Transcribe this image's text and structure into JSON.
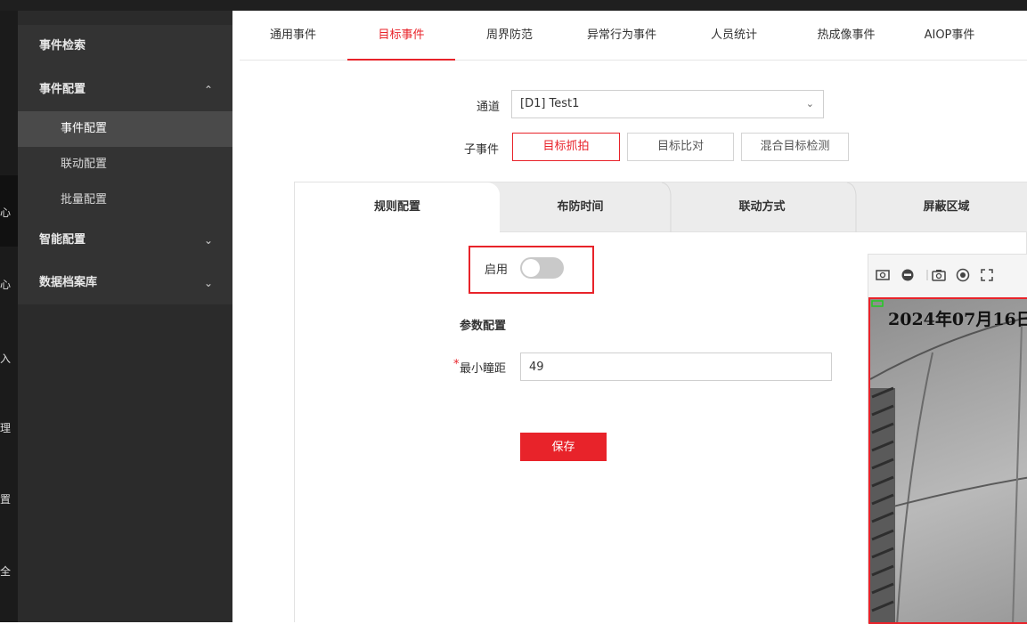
{
  "sidebar": {
    "items": [
      {
        "label": "事件检索"
      },
      {
        "label": "事件配置"
      },
      {
        "label": "智能配置"
      },
      {
        "label": "数据档案库"
      }
    ],
    "sub_items": [
      {
        "label": "事件配置"
      },
      {
        "label": "联动配置"
      },
      {
        "label": "批量配置"
      }
    ],
    "rail_glyphs": [
      "心",
      "心",
      "入",
      "理",
      "置",
      "全"
    ]
  },
  "tabs": [
    {
      "label": "通用事件"
    },
    {
      "label": "目标事件"
    },
    {
      "label": "周界防范"
    },
    {
      "label": "异常行为事件"
    },
    {
      "label": "人员统计"
    },
    {
      "label": "热成像事件"
    },
    {
      "label": "AIOP事件"
    }
  ],
  "form": {
    "channel_label": "通道",
    "channel_value": "[D1] Test1",
    "subevent_label": "子事件",
    "subevents": [
      {
        "label": "目标抓拍"
      },
      {
        "label": "目标比对"
      },
      {
        "label": "混合目标检测"
      }
    ]
  },
  "panel": {
    "tabs": [
      {
        "label": "规则配置"
      },
      {
        "label": "布防时间"
      },
      {
        "label": "联动方式"
      },
      {
        "label": "屏蔽区域"
      }
    ],
    "enable_label": "启用",
    "enabled": false,
    "section_title": "参数配置",
    "required_mark": "*",
    "min_pupil_label": "最小瞳距",
    "min_pupil_value": "49",
    "save_label": "保存"
  },
  "video": {
    "osd_text": "2024年07月16日"
  },
  "colors": {
    "accent": "#e8232a",
    "sidebar_bg": "#2b2b2b",
    "sidebar_panel": "#333333"
  }
}
